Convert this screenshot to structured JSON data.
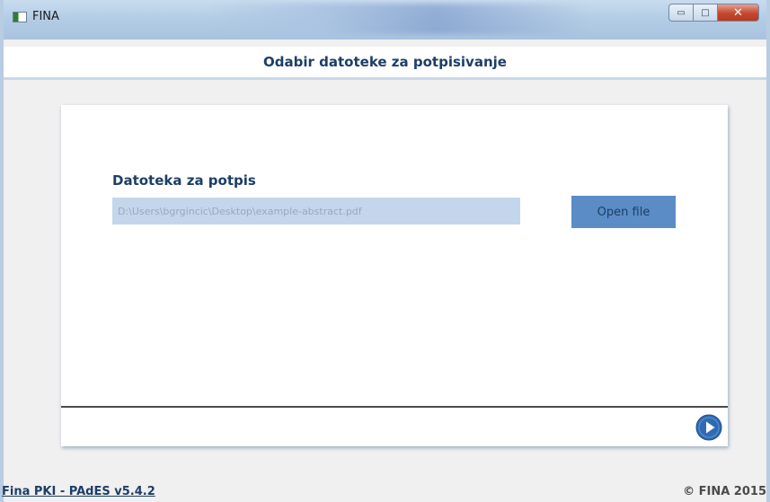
{
  "window": {
    "title": "FINA",
    "minimize_symbol": "▭",
    "maximize_symbol": "□",
    "close_symbol": "✕"
  },
  "header": {
    "title": "Odabir datoteke za potpisivanje"
  },
  "form": {
    "field_label": "Datoteka za potpis",
    "file_path": "D:\\Users\\bgrgincic\\Desktop\\example-abstract.pdf",
    "open_button_label": "Open file"
  },
  "navigation": {
    "next_icon": "play-circle-icon"
  },
  "footer": {
    "version": "Fina PKI - PAdES  v5.4.2",
    "copyright": "© FINA 2015"
  },
  "colors": {
    "accent": "#1d3e66",
    "button": "#5b8cc6",
    "input_bg": "#c4d6ec"
  }
}
